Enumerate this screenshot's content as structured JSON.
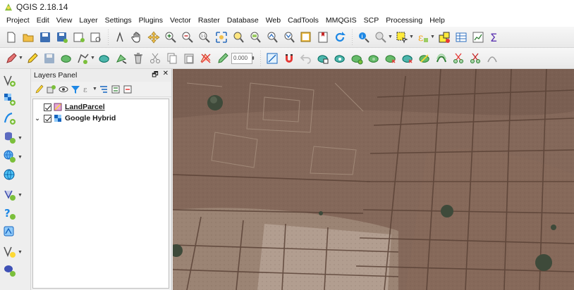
{
  "window": {
    "title": "QGIS 2.18.14"
  },
  "menubar": {
    "items": [
      "Project",
      "Edit",
      "View",
      "Layer",
      "Settings",
      "Plugins",
      "Vector",
      "Raster",
      "Database",
      "Web",
      "CadTools",
      "MMQGIS",
      "SCP",
      "Processing",
      "Help"
    ]
  },
  "toolbar2": {
    "spin_value": "0.000"
  },
  "layers_panel": {
    "title": "Layers Panel",
    "float_glyph": "🗗",
    "close_glyph": "✕",
    "layers": [
      {
        "name": "LandParcel",
        "checked": true,
        "icon": "polygon-layer-icon"
      },
      {
        "name": "Google Hybrid",
        "checked": true,
        "icon": "raster-layer-icon",
        "expanded": true
      }
    ]
  },
  "colors": {
    "map_base": "#84685a",
    "field_light": "#b09a8a",
    "field_dark": "#6f5548",
    "tree": "#3e4a3a"
  }
}
